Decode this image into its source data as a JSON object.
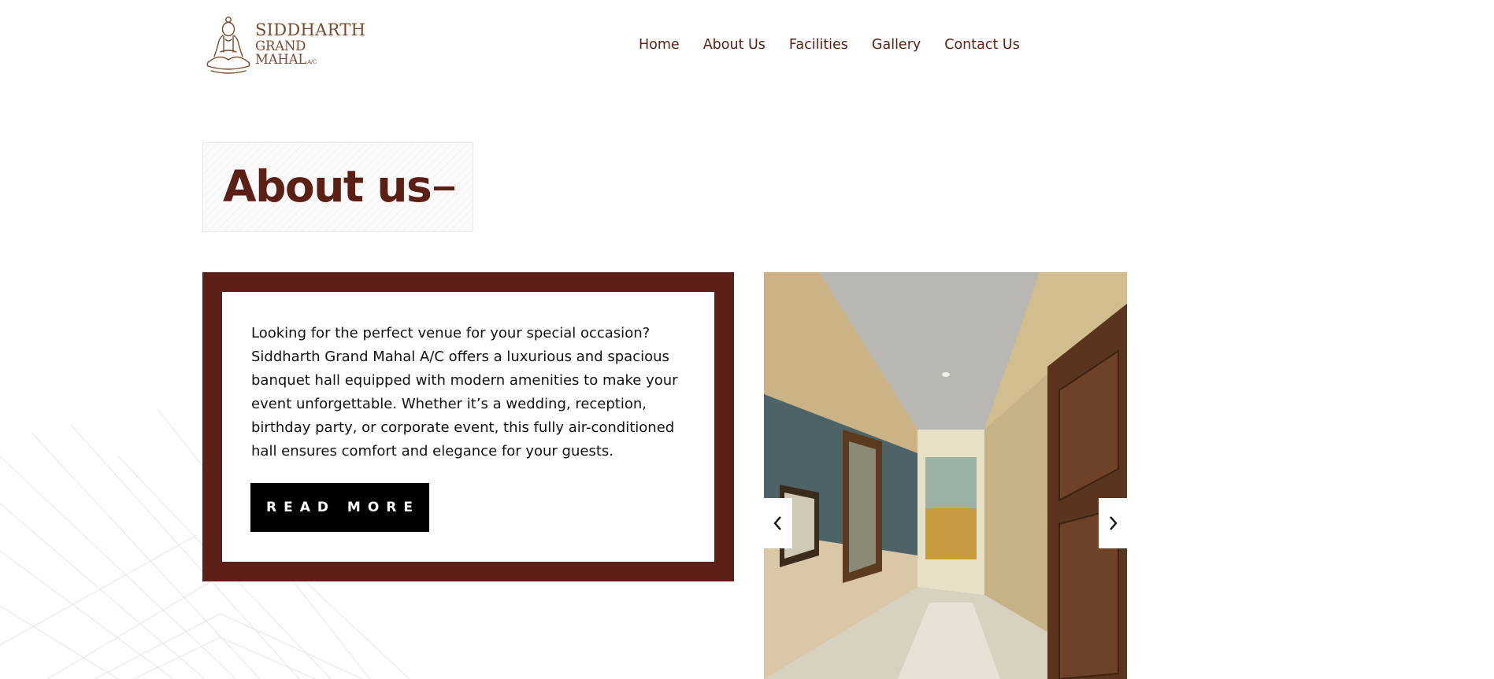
{
  "brand": {
    "line1": "SIDDHARTH",
    "line2": "GRAND MAHAL",
    "suffix": "A/C",
    "color": "#7b4a2e"
  },
  "nav": {
    "items": [
      "Home",
      "About Us",
      "Facilities",
      "Gallery",
      "Contact Us"
    ],
    "color": "#5a1f14"
  },
  "about": {
    "title": "About us",
    "body": "Looking for the perfect venue for your special occasion? Siddharth Grand Mahal A/C offers a luxurious and spacious banquet hall equipped with modern amenities to make your event unforgettable. Whether it’s a wedding, reception, birthday party, or corporate event, this fully air-conditioned hall ensures comfort and elegance for your guests.",
    "button_label": "READ MORE",
    "accent": "#5c2019"
  },
  "slider": {
    "image": "hallway-photo",
    "prev_icon": "chevron-left-icon",
    "next_icon": "chevron-right-icon"
  }
}
